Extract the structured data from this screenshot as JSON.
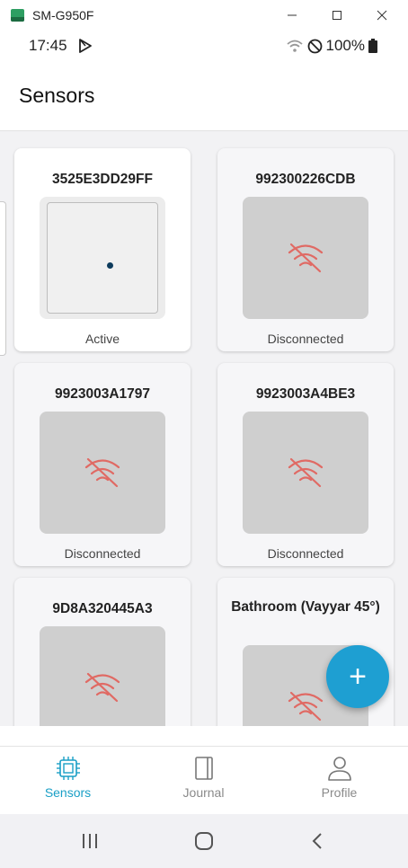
{
  "window": {
    "title": "SM-G950F",
    "minimize": "—",
    "maximize": "☐",
    "close": "✕"
  },
  "status_bar": {
    "time": "17:45",
    "battery": "100%"
  },
  "app_bar": {
    "title": "Sensors"
  },
  "sensors": [
    {
      "name": "3525E3DD29FF",
      "status": "Active"
    },
    {
      "name": "992300226CDB",
      "status": "Disconnected"
    },
    {
      "name": "9923003A1797",
      "status": "Disconnected"
    },
    {
      "name": "9923003A4BE3",
      "status": "Disconnected"
    },
    {
      "name": "9D8A320445A3",
      "status": ""
    },
    {
      "name": "Bathroom (Vayyar 45°)",
      "status": ""
    }
  ],
  "fab": {
    "label": "+"
  },
  "bottom_nav": {
    "items": [
      {
        "label": "Sensors",
        "icon": "chip-icon",
        "selected": true
      },
      {
        "label": "Journal",
        "icon": "book-icon",
        "selected": false
      },
      {
        "label": "Profile",
        "icon": "person-icon",
        "selected": false
      }
    ]
  },
  "colors": {
    "accent": "#1a9fc6",
    "fab": "#1e9fd2",
    "disconnected_icon": "#e06a64",
    "active_dot": "#0d3b5c"
  }
}
